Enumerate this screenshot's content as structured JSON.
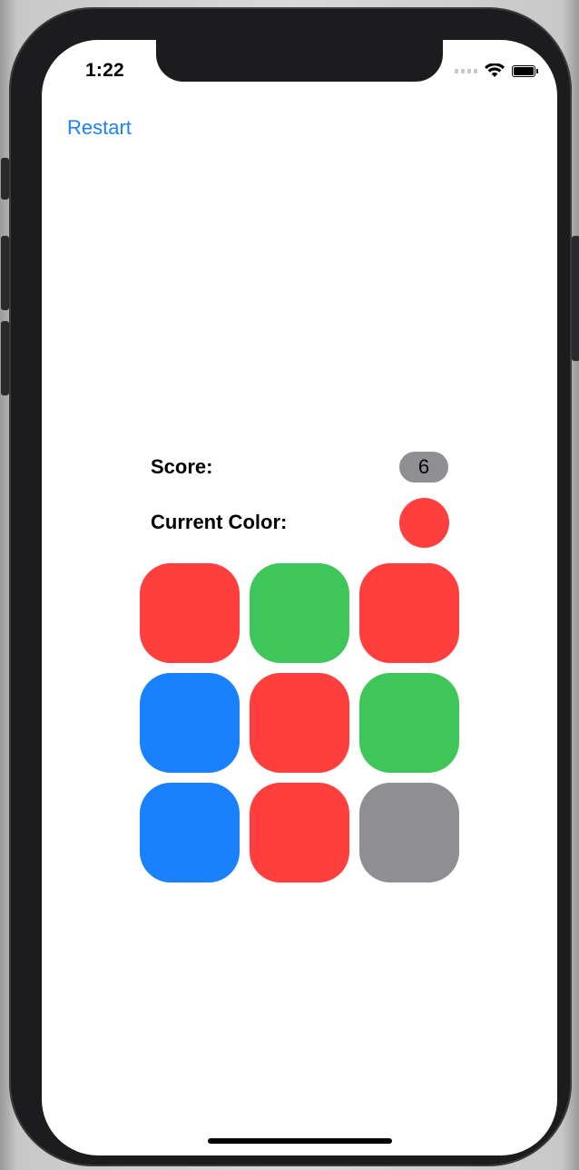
{
  "status_bar": {
    "time": "1:22",
    "icons": [
      "cellular-signal-icon",
      "wifi-icon",
      "battery-icon"
    ]
  },
  "nav": {
    "restart_label": "Restart",
    "accent": "#1a82f7"
  },
  "game": {
    "score_label": "Score:",
    "score_value": "6",
    "current_color_label": "Current Color:",
    "current_color": "#ff3f3d",
    "colors": {
      "red": "#ff3f3d",
      "green": "#3ec65a",
      "blue": "#1a80fc",
      "gray": "#8e8e93"
    },
    "tiles": [
      {
        "color": "red"
      },
      {
        "color": "green"
      },
      {
        "color": "red"
      },
      {
        "color": "blue"
      },
      {
        "color": "red"
      },
      {
        "color": "green"
      },
      {
        "color": "blue"
      },
      {
        "color": "red"
      },
      {
        "color": "gray"
      }
    ]
  }
}
